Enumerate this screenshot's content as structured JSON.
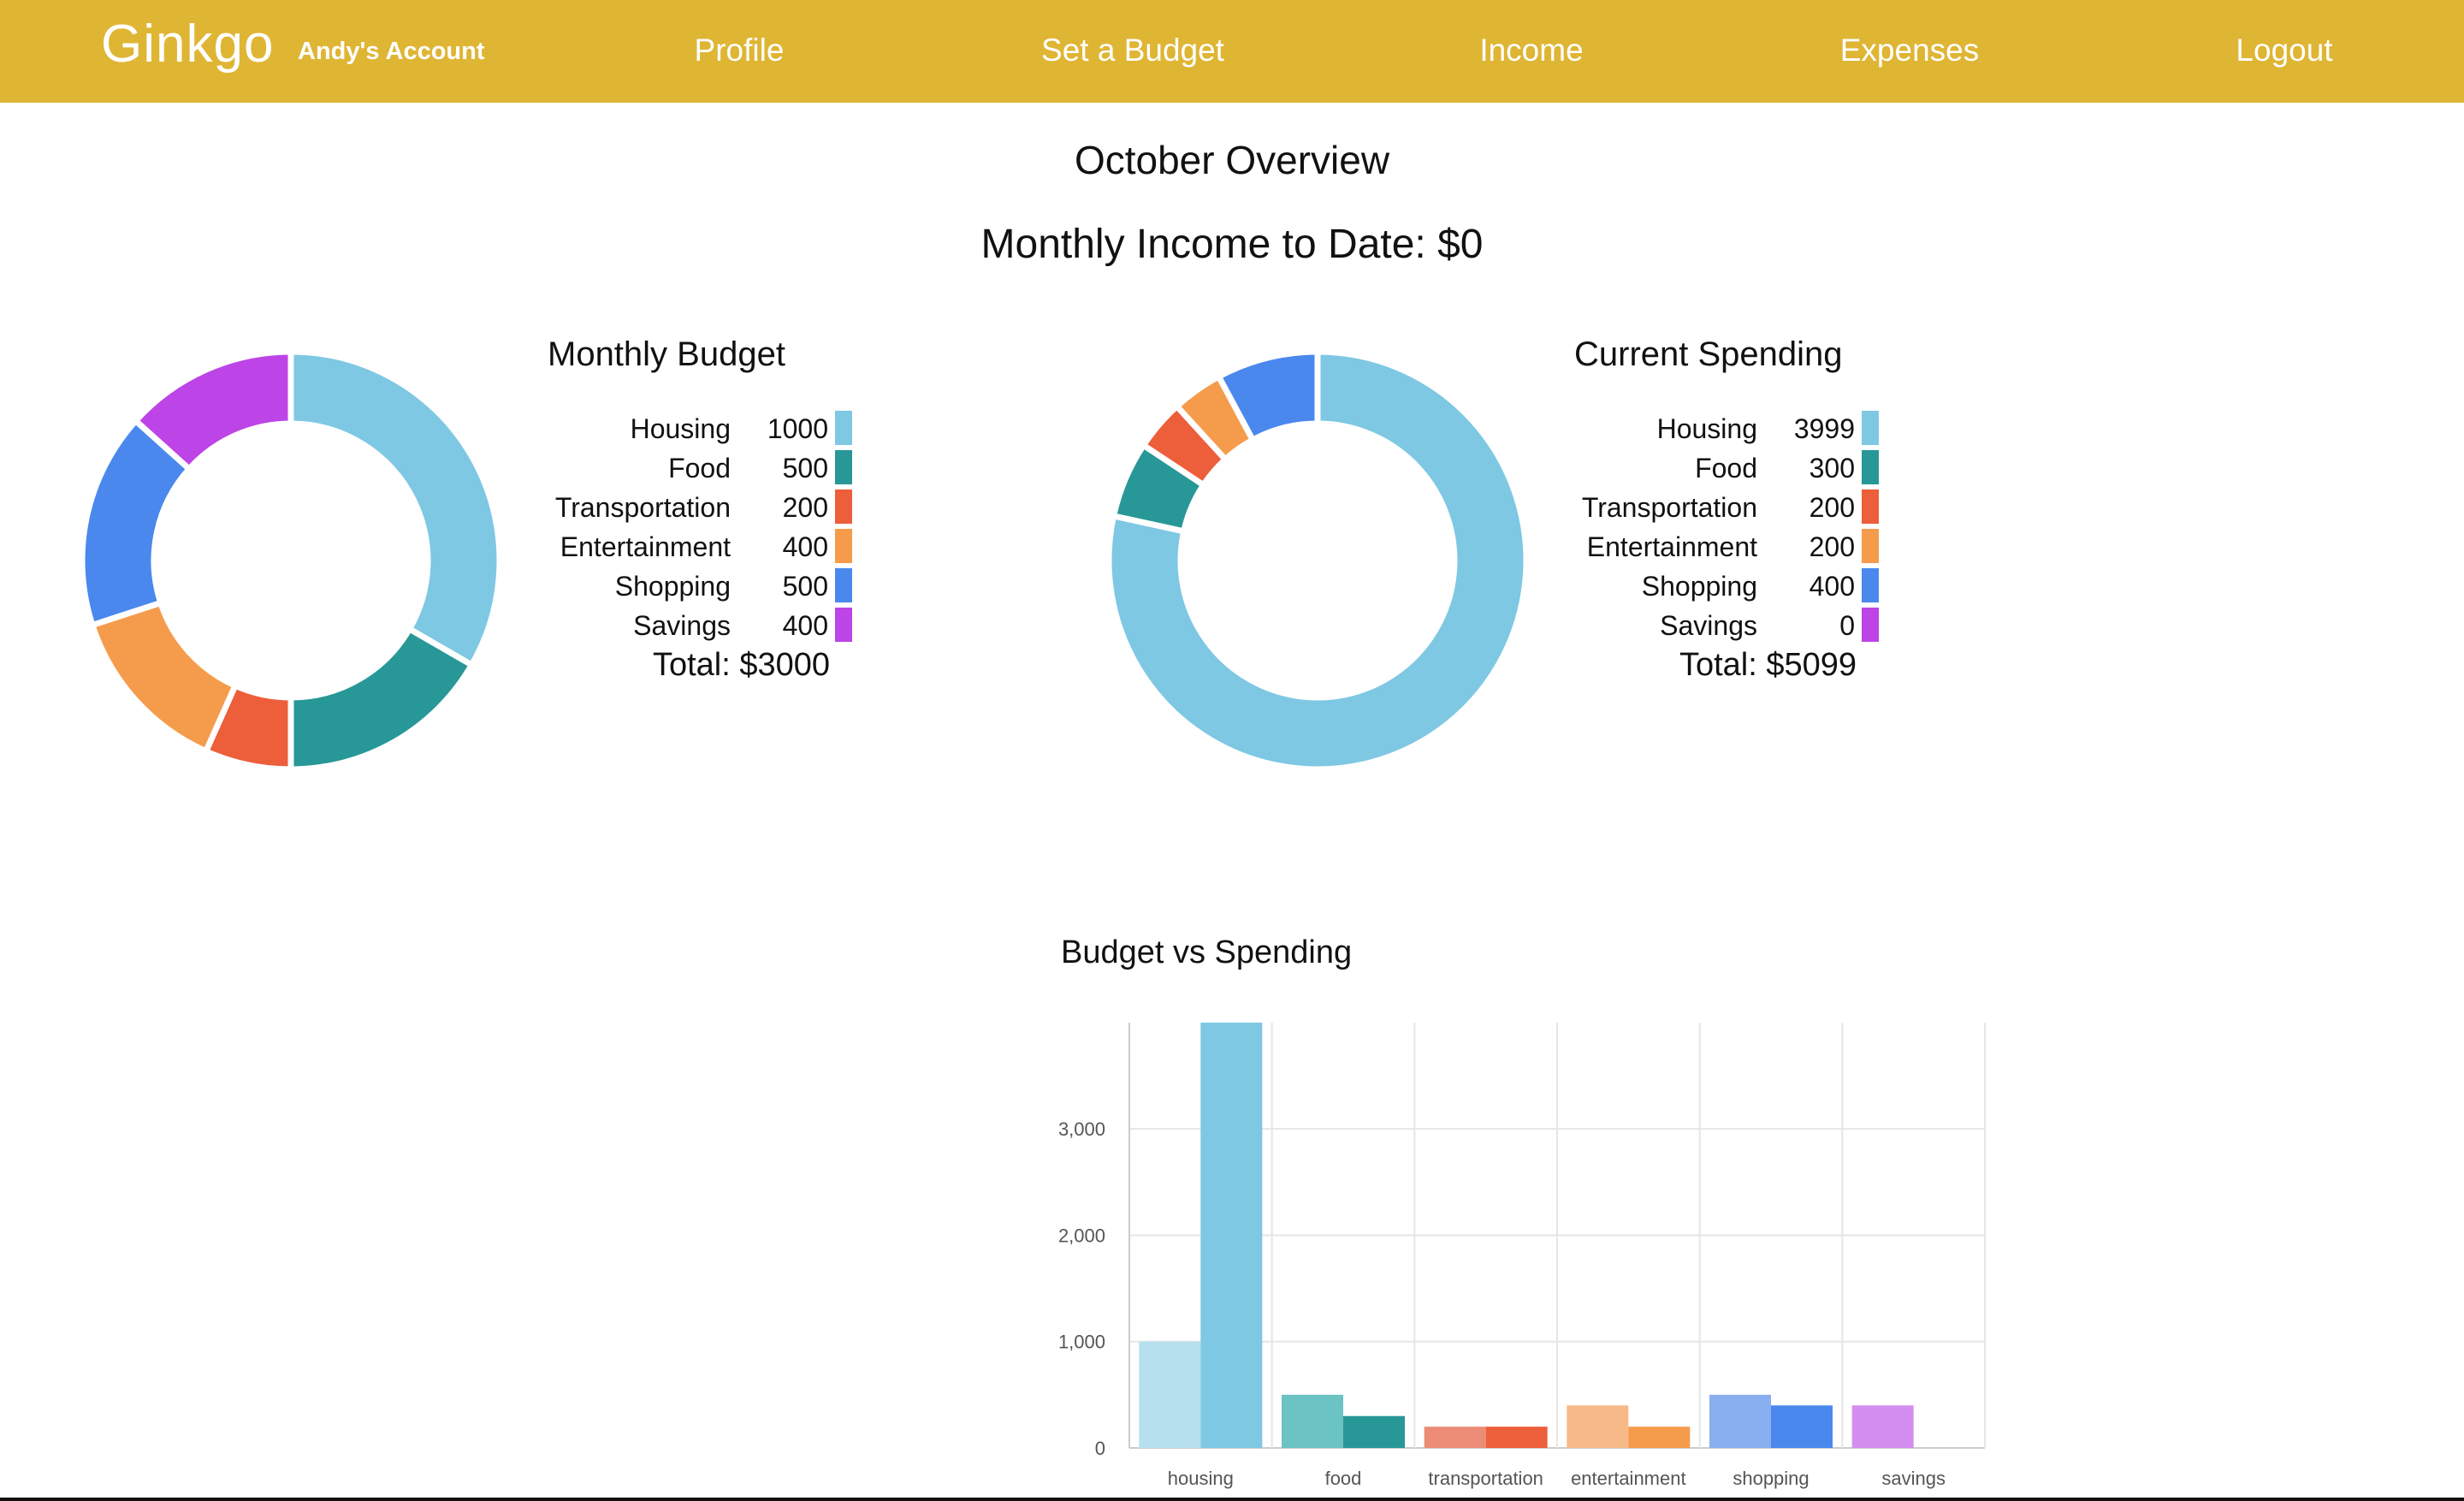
{
  "nav": {
    "brand": "Ginkgo",
    "account": "Andy's Account",
    "links": [
      "Profile",
      "Set a Budget",
      "Income",
      "Expenses",
      "Logout"
    ]
  },
  "page": {
    "title": "October Overview",
    "income": "Monthly Income to Date: $0"
  },
  "colors": {
    "nav_bg": "#dfb534",
    "housing": "#7ec8e3",
    "food": "#289797",
    "transportation": "#ed5e3b",
    "entertainment": "#f59c4c",
    "shopping": "#4a88ee",
    "savings": "#bd44e6"
  },
  "budget": {
    "title": "Monthly Budget",
    "total": "Total: $3000",
    "items": [
      {
        "label": "Housing",
        "value": "1000"
      },
      {
        "label": "Food",
        "value": "500"
      },
      {
        "label": "Transportation",
        "value": "200"
      },
      {
        "label": "Entertainment",
        "value": "400"
      },
      {
        "label": "Shopping",
        "value": "500"
      },
      {
        "label": "Savings",
        "value": "400"
      }
    ]
  },
  "spending": {
    "title": "Current Spending",
    "total": "Total: $5099",
    "items": [
      {
        "label": "Housing",
        "value": "3999"
      },
      {
        "label": "Food",
        "value": "300"
      },
      {
        "label": "Transportation",
        "value": "200"
      },
      {
        "label": "Entertainment",
        "value": "200"
      },
      {
        "label": "Shopping",
        "value": "400"
      },
      {
        "label": "Savings",
        "value": "0"
      }
    ]
  },
  "chart_data": [
    {
      "type": "pie",
      "style": "donut",
      "title": "Monthly Budget",
      "categories": [
        "Housing",
        "Food",
        "Transportation",
        "Entertainment",
        "Shopping",
        "Savings"
      ],
      "values": [
        1000,
        500,
        200,
        400,
        500,
        400
      ],
      "colors": [
        "#7ec8e3",
        "#289797",
        "#ed5e3b",
        "#f59c4c",
        "#4a88ee",
        "#bd44e6"
      ]
    },
    {
      "type": "pie",
      "style": "donut",
      "title": "Current Spending",
      "categories": [
        "Housing",
        "Food",
        "Transportation",
        "Entertainment",
        "Shopping",
        "Savings"
      ],
      "values": [
        3999,
        300,
        200,
        200,
        400,
        0
      ],
      "colors": [
        "#7ec8e3",
        "#289797",
        "#ed5e3b",
        "#f59c4c",
        "#4a88ee",
        "#bd44e6"
      ]
    },
    {
      "type": "bar",
      "title": "Budget vs Spending",
      "categories": [
        "housing",
        "food",
        "transportation",
        "entertainment",
        "shopping",
        "savings"
      ],
      "series": [
        {
          "values": [
            1000,
            500,
            200,
            400,
            500,
            400
          ]
        },
        {
          "values": [
            3999,
            300,
            200,
            200,
            400,
            0
          ]
        }
      ],
      "ylim": [
        0,
        3999
      ],
      "yticks": [
        0,
        1000,
        2000,
        3000
      ],
      "ytick_labels": [
        "0",
        "1,000",
        "2,000",
        "3,000"
      ],
      "grid": true,
      "light_colors": [
        "#b7e0ef",
        "#6cc3c3",
        "#ec8c76",
        "#f8b988",
        "#8aaff1",
        "#d48ef0"
      ],
      "colors": [
        "#7ec8e3",
        "#289797",
        "#ed5e3b",
        "#f59c4c",
        "#4a88ee",
        "#bd44e6"
      ]
    }
  ]
}
